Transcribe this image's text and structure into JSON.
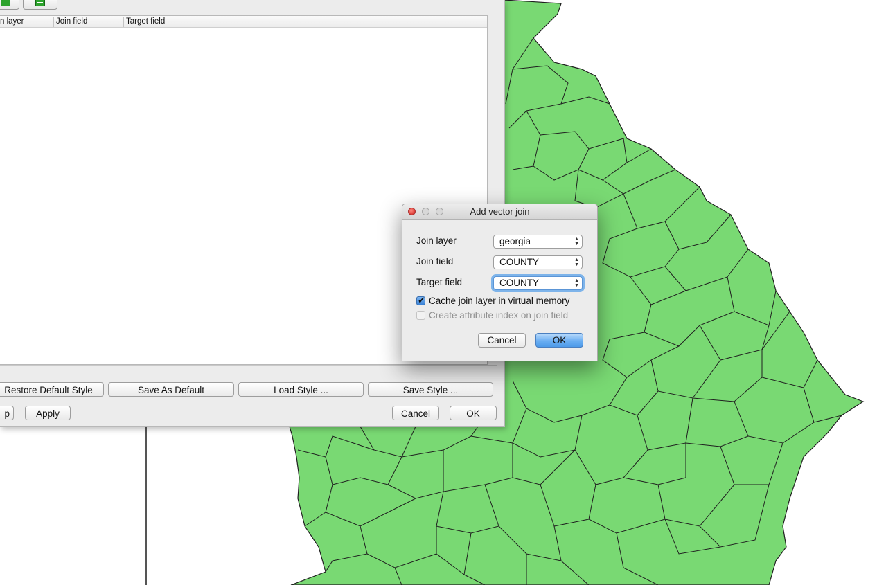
{
  "colors": {
    "map_fill": "#79d973",
    "map_border": "#1f1f1f",
    "accent": "#4e9be9"
  },
  "properties_window": {
    "toolbar_icons": [
      "add-join-icon",
      "remove-join-icon"
    ],
    "table_columns": [
      "n layer",
      "Join field",
      "Target field"
    ],
    "style_buttons": {
      "restore_default": "Restore Default Style",
      "save_as_default": "Save As Default",
      "load_style": "Load Style ...",
      "save_style": "Save Style ..."
    },
    "bottom_buttons": {
      "help": "p",
      "apply": "Apply",
      "cancel": "Cancel",
      "ok": "OK"
    }
  },
  "dialog": {
    "title": "Add vector join",
    "join_layer_label": "Join layer",
    "join_layer_value": "georgia",
    "join_field_label": "Join field",
    "join_field_value": "COUNTY",
    "target_field_label": "Target field",
    "target_field_value": "COUNTY",
    "cache_label": "Cache join layer in virtual memory",
    "cache_checked": true,
    "index_label": "Create attribute index on join field",
    "index_checked": false,
    "index_enabled": false,
    "cancel_label": "Cancel",
    "ok_label": "OK"
  }
}
